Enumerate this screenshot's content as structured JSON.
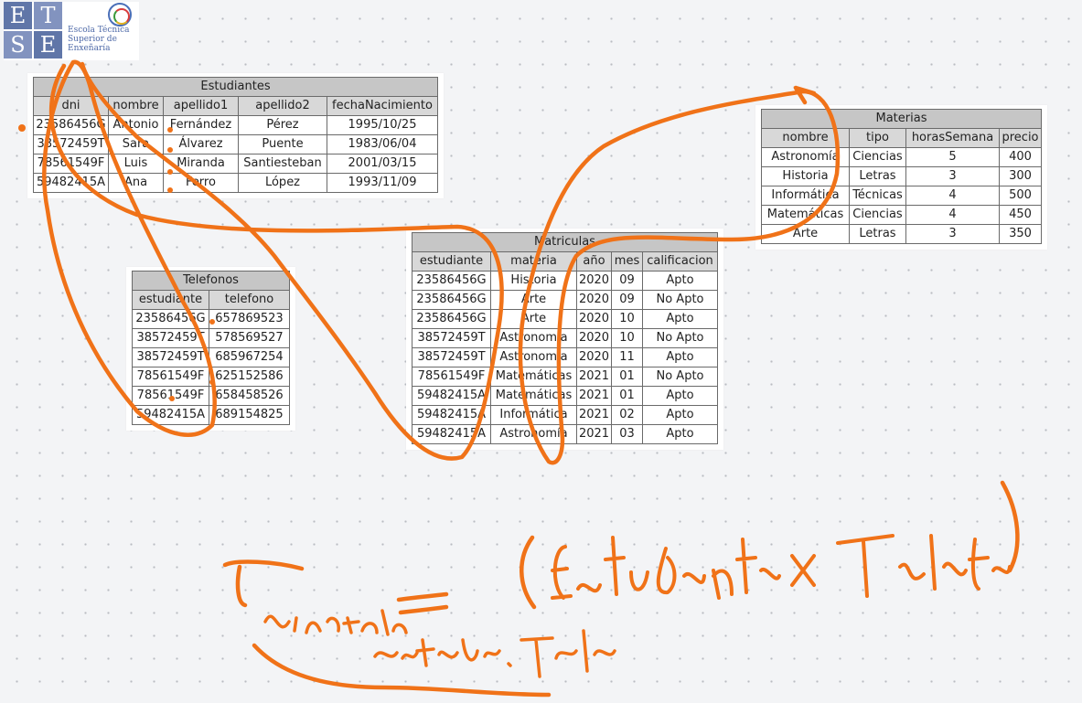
{
  "logo": {
    "letters": [
      "E",
      "T",
      "S",
      "E"
    ],
    "school_lines": [
      "Escola Técnica",
      "Superior de",
      "Enxeñaría"
    ]
  },
  "ink_color": "#f07218",
  "tables": {
    "estudiantes": {
      "name": "Estudiantes",
      "columns": [
        "dni",
        "nombre",
        "apellido1",
        "apellido2",
        "fechaNacimiento"
      ],
      "rows": [
        [
          "23586456G",
          "Antonio",
          "Fernández",
          "Pérez",
          "1995/10/25"
        ],
        [
          "38572459T",
          "Sara",
          "Álvarez",
          "Puente",
          "1983/06/04"
        ],
        [
          "78561549F",
          "Luis",
          "Miranda",
          "Santiesteban",
          "2001/03/15"
        ],
        [
          "59482415A",
          "Ana",
          "Ferro",
          "López",
          "1993/11/09"
        ]
      ]
    },
    "telefonos": {
      "name": "Telefonos",
      "columns": [
        "estudiante",
        "telefono"
      ],
      "rows": [
        [
          "23586456G",
          "657869523"
        ],
        [
          "38572459T",
          "578569527"
        ],
        [
          "38572459T",
          "685967254"
        ],
        [
          "78561549F",
          "625152586"
        ],
        [
          "78561549F",
          "658458526"
        ],
        [
          "59482415A",
          "689154825"
        ]
      ]
    },
    "matriculas": {
      "name": "Matriculas",
      "columns": [
        "estudiante",
        "materia",
        "año",
        "mes",
        "calificacion"
      ],
      "rows": [
        [
          "23586456G",
          "Historia",
          "2020",
          "09",
          "Apto"
        ],
        [
          "23586456G",
          "Arte",
          "2020",
          "09",
          "No Apto"
        ],
        [
          "23586456G",
          "Arte",
          "2020",
          "10",
          "Apto"
        ],
        [
          "38572459T",
          "Astronomía",
          "2020",
          "10",
          "No Apto"
        ],
        [
          "38572459T",
          "Astronomía",
          "2020",
          "11",
          "Apto"
        ],
        [
          "78561549F",
          "Matemáticas",
          "2021",
          "01",
          "No Apto"
        ],
        [
          "59482415A",
          "Matemáticas",
          "2021",
          "01",
          "Apto"
        ],
        [
          "59482415A",
          "Informática",
          "2021",
          "02",
          "Apto"
        ],
        [
          "59482415A",
          "Astronomía",
          "2021",
          "03",
          "Apto"
        ]
      ]
    },
    "materias": {
      "name": "Materias",
      "columns": [
        "nombre",
        "tipo",
        "horasSemana",
        "precio"
      ],
      "rows": [
        [
          "Astronomía",
          "Ciencias",
          "5",
          "400"
        ],
        [
          "Historia",
          "Letras",
          "3",
          "300"
        ],
        [
          "Informática",
          "Técnicas",
          "4",
          "500"
        ],
        [
          "Matemáticas",
          "Ciencias",
          "4",
          "450"
        ],
        [
          "Arte",
          "Letras",
          "3",
          "350"
        ]
      ]
    }
  }
}
